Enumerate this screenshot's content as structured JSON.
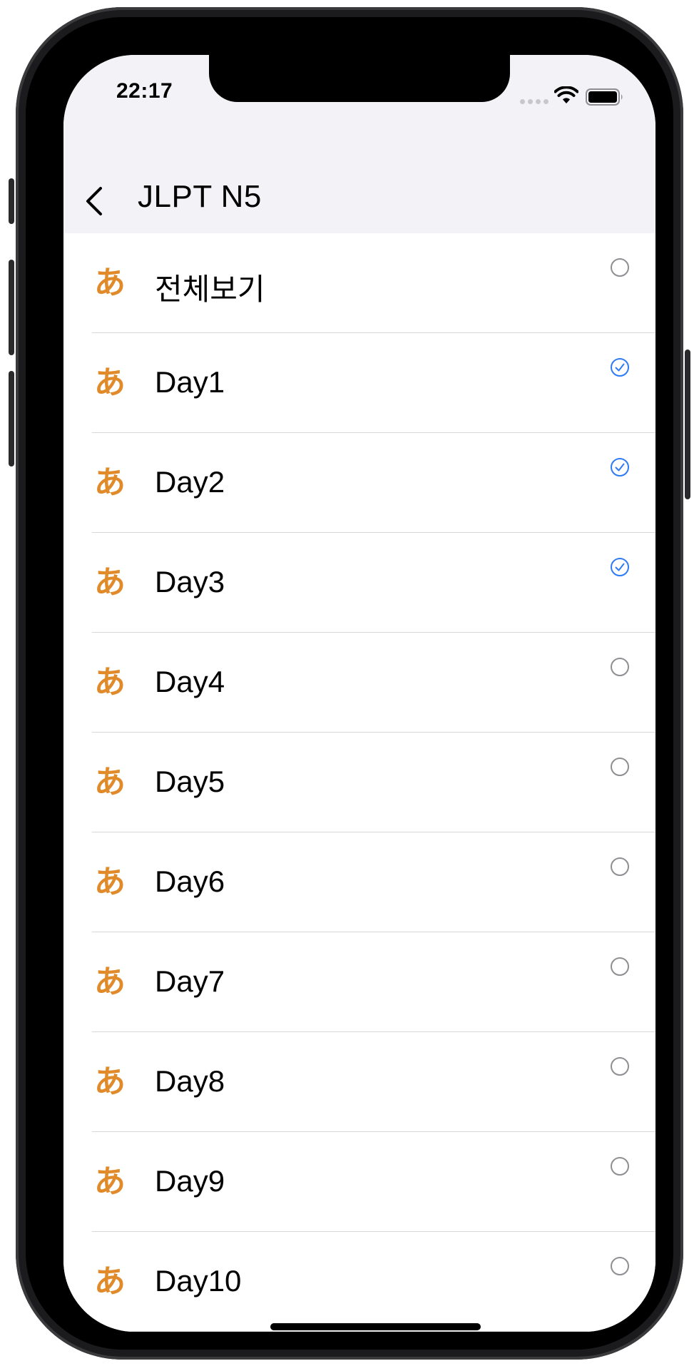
{
  "status_bar": {
    "time": "22:17"
  },
  "nav": {
    "title": "JLPT N5"
  },
  "colors": {
    "accent": "#2f7bf5",
    "icon": "#e08a2a",
    "unchecked": "#8e8e93"
  },
  "list": {
    "items": [
      {
        "label": "전체보기",
        "icon": "あ",
        "checked": false
      },
      {
        "label": "Day1",
        "icon": "あ",
        "checked": true
      },
      {
        "label": "Day2",
        "icon": "あ",
        "checked": true
      },
      {
        "label": "Day3",
        "icon": "あ",
        "checked": true
      },
      {
        "label": "Day4",
        "icon": "あ",
        "checked": false
      },
      {
        "label": "Day5",
        "icon": "あ",
        "checked": false
      },
      {
        "label": "Day6",
        "icon": "あ",
        "checked": false
      },
      {
        "label": "Day7",
        "icon": "あ",
        "checked": false
      },
      {
        "label": "Day8",
        "icon": "あ",
        "checked": false
      },
      {
        "label": "Day9",
        "icon": "あ",
        "checked": false
      },
      {
        "label": "Day10",
        "icon": "あ",
        "checked": false
      }
    ]
  }
}
